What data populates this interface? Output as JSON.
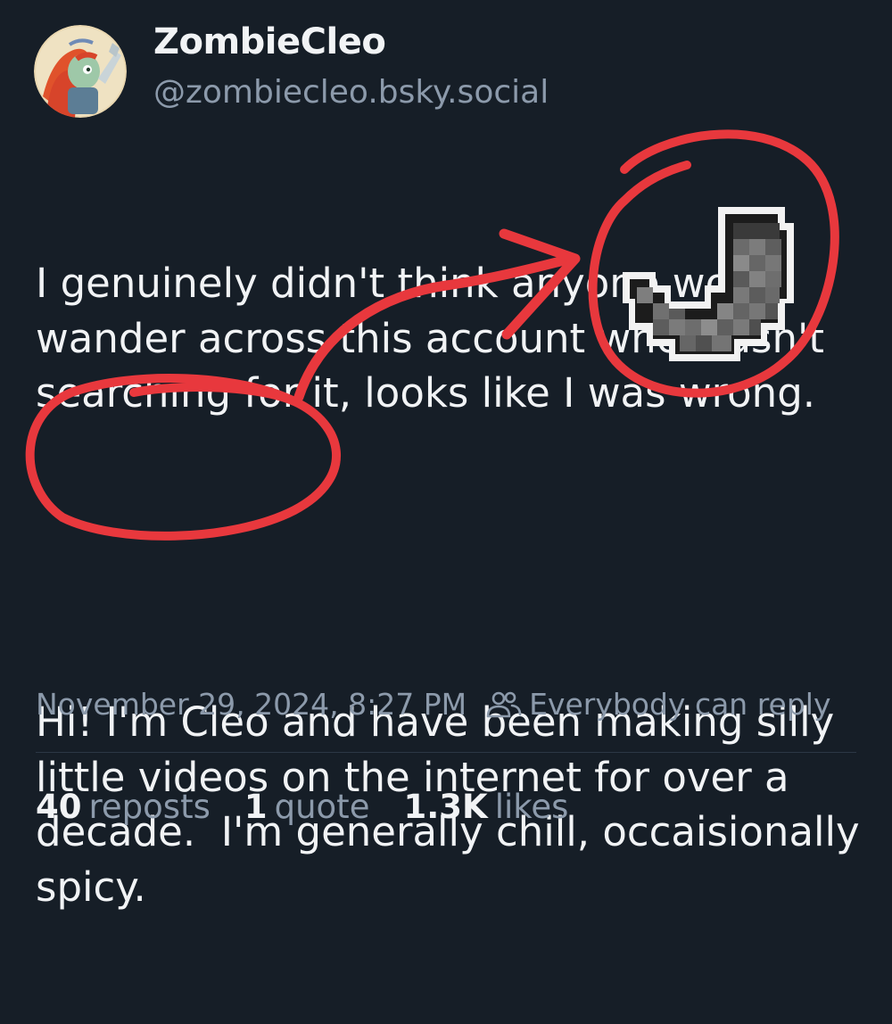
{
  "author": {
    "display_name": "ZombieCleo",
    "handle": "@zombiecleo.bsky.social"
  },
  "post": {
    "paragraph_1": "I genuinely didn't think anyone would wander across this account who wasn't searching for it, looks like I was wrong.",
    "paragraph_2": "Hi! I'm Cleo and have been making silly little videos on the internet for over a decade.  I'm generally chill, occaisionally spicy.",
    "timestamp": "November 29, 2024, 8:27 PM",
    "reply_setting": "Everybody can reply"
  },
  "stats": {
    "reposts_count": "40",
    "reposts_label": "reposts",
    "quotes_count": "1",
    "quotes_label": "quote",
    "likes_count": "1.3K",
    "likes_label": "likes"
  },
  "annotation": {
    "color": "#e8383d",
    "pixel_item": "minecraft-style gray boot/pipe sprite"
  },
  "colors": {
    "background": "#161e27",
    "text_primary": "#f1f3f5",
    "text_secondary": "#8c9aab"
  }
}
